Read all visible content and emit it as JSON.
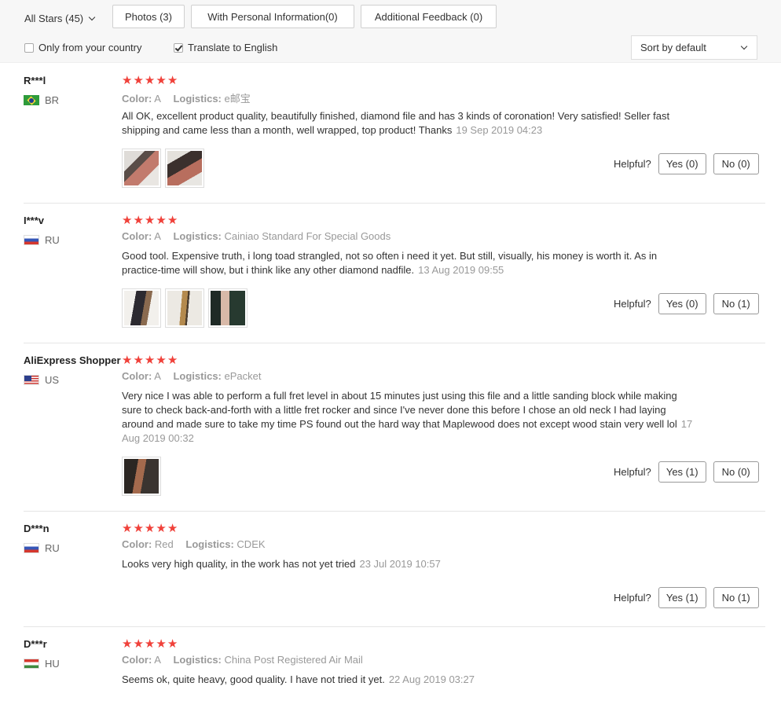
{
  "filters": {
    "stars_select": "All Stars (45)",
    "photos": "Photos (3)",
    "personal": "With Personal Information(0)",
    "additional": "Additional Feedback (0)"
  },
  "options": {
    "only_country": "Only from your country",
    "only_country_checked": false,
    "translate": "Translate to English",
    "translate_checked": true
  },
  "sort": {
    "value": "Sort by default"
  },
  "labels": {
    "color": "Color:",
    "logistics": "Logistics:",
    "helpful": "Helpful?"
  },
  "reviews": [
    {
      "user": "R***l",
      "country": "BR",
      "stars": 5,
      "color": "A",
      "logistics": "e邮宝",
      "text": "All OK, excellent product quality, beautifully finished, diamond file and has 3 kinds of coronation! Very satisfied! Seller fast shipping and came less than a month, well wrapped, top product! Thanks",
      "date": "19 Sep 2019 04:23",
      "photos": 2,
      "yes": "Yes (0)",
      "no": "No (0)"
    },
    {
      "user": "I***v",
      "country": "RU",
      "stars": 5,
      "color": "A",
      "logistics": "Cainiao Standard For Special Goods",
      "text": "Good tool. Expensive truth, i long toad strangled, not so often i need it yet. But still, visually, his money is worth it. As in practice-time will show, but i think like any other diamond nadfile.",
      "date": "13 Aug 2019 09:55",
      "photos": 3,
      "yes": "Yes (0)",
      "no": "No (1)"
    },
    {
      "user": "AliExpress Shopper",
      "country": "US",
      "stars": 5,
      "color": "A",
      "logistics": "ePacket",
      "text": "Very nice I was able to perform a full fret level in about 15 minutes just using this file and a little sanding block while making sure to check back-and-forth with a little fret rocker and since I've never done this before I chose an old neck I had laying around and made sure to take my time PS found out the hard way that Maplewood does not except wood stain very well lol",
      "date": "17 Aug 2019 00:32",
      "photos": 1,
      "yes": "Yes (1)",
      "no": "No (0)"
    },
    {
      "user": "D***n",
      "country": "RU",
      "stars": 5,
      "color": "Red",
      "logistics": "CDEK",
      "text": "Looks very high quality, in the work has not yet tried",
      "date": "23 Jul 2019 10:57",
      "photos": 0,
      "yes": "Yes (1)",
      "no": "No (1)"
    },
    {
      "user": "D***r",
      "country": "HU",
      "stars": 5,
      "color": "A",
      "logistics": "China Post Registered Air Mail",
      "text": "Seems ok, quite heavy, good quality. I have not tried it yet.",
      "date": "22 Aug 2019 03:27",
      "photos": 0,
      "yes": "",
      "no": ""
    }
  ],
  "colors": {
    "star": "#f0413a",
    "muted": "#999999",
    "text": "#333333"
  }
}
